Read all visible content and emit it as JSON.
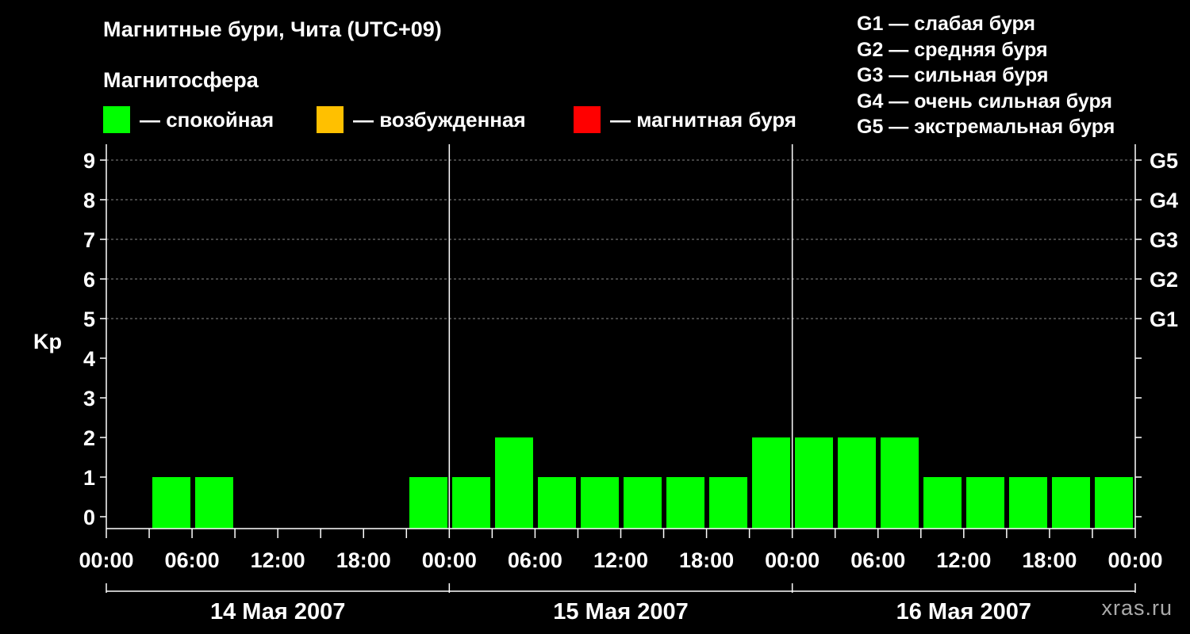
{
  "chart_data": {
    "type": "bar",
    "title": "Магнитные бури, Чита (UTC+09)",
    "subtitle": "Магнитосфера",
    "ylabel": "Kp",
    "ylim": [
      0,
      9
    ],
    "yticks": [
      "0",
      "1",
      "2",
      "3",
      "4",
      "5",
      "6",
      "7",
      "8",
      "9"
    ],
    "g_levels": [
      {
        "kp": 5,
        "label": "G1"
      },
      {
        "kp": 6,
        "label": "G2"
      },
      {
        "kp": 7,
        "label": "G3"
      },
      {
        "kp": 8,
        "label": "G4"
      },
      {
        "kp": 9,
        "label": "G5"
      }
    ],
    "x_tick_labels": [
      "00:00",
      "06:00",
      "12:00",
      "18:00",
      "00:00",
      "06:00",
      "12:00",
      "18:00",
      "00:00",
      "06:00",
      "12:00",
      "18:00",
      "00:00"
    ],
    "days": [
      "14 Мая 2007",
      "15 Мая 2007",
      "16 Мая 2007"
    ],
    "interval_hours": 3,
    "values": [
      0,
      1,
      1,
      0,
      0,
      0,
      0,
      1,
      1,
      2,
      1,
      1,
      1,
      1,
      1,
      2,
      2,
      2,
      2,
      1,
      1,
      1,
      1,
      1
    ],
    "colors": {
      "quiet": "#00ff00",
      "disturbed": "#ffc000",
      "storm": "#ff0000"
    },
    "grid": true
  },
  "legend": {
    "quiet": "— спокойная",
    "disturbed": "— возбужденная",
    "storm": "— магнитная буря"
  },
  "g_legend": [
    "G1 — слабая буря",
    "G2 — средняя буря",
    "G3 — сильная буря",
    "G4 — очень сильная буря",
    "G5 — экстремальная буря"
  ],
  "watermark": "xras.ru"
}
